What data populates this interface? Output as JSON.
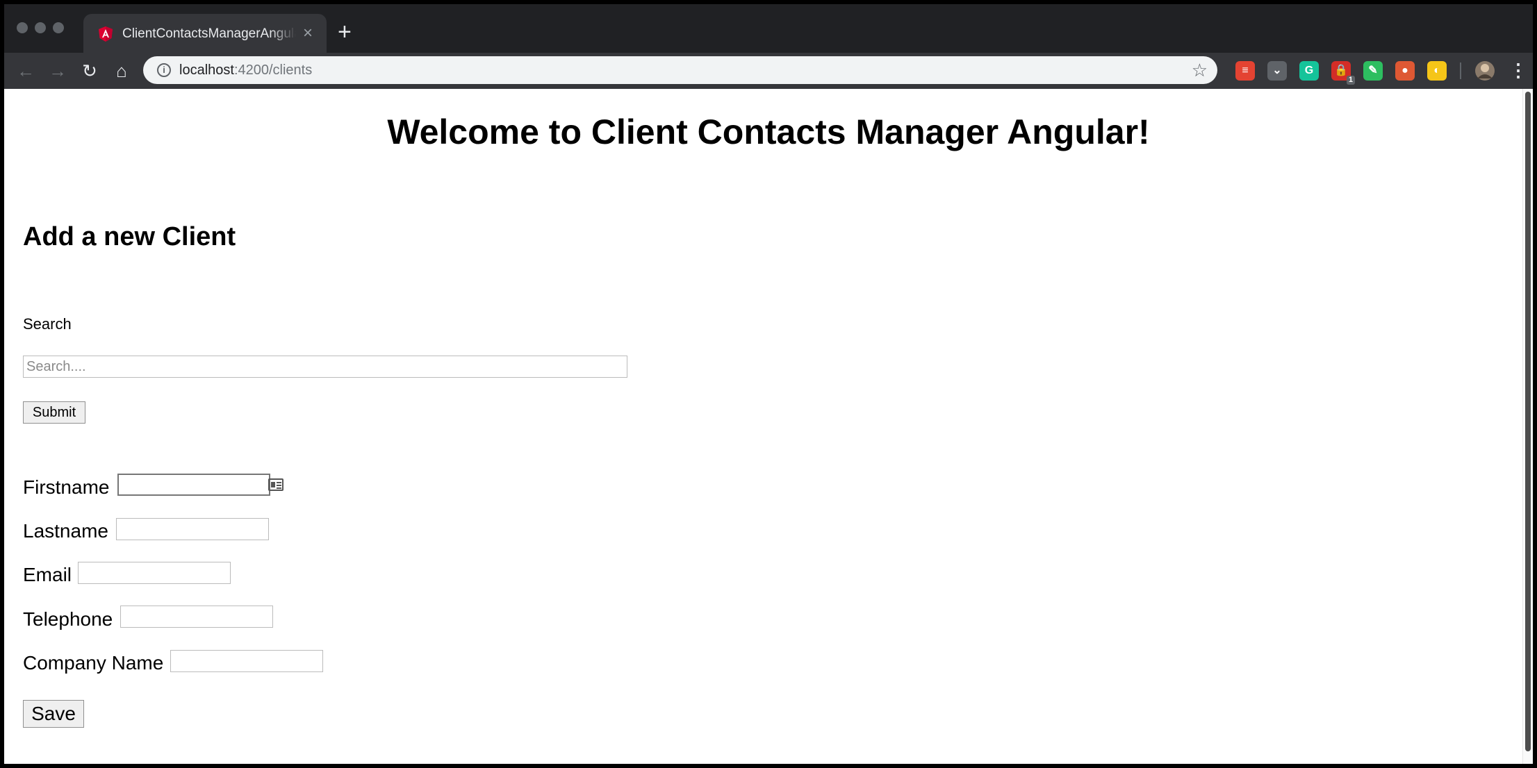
{
  "browser": {
    "tab": {
      "title": "ClientContactsManagerAngular",
      "favicon": "angular-logo-icon",
      "close_glyph": "×"
    },
    "new_tab_glyph": "+",
    "address": {
      "host": "localhost",
      "path": ":4200/clients"
    },
    "extensions": [
      {
        "name": "todoist-extension-icon",
        "color": "#e44332",
        "glyph": "≡"
      },
      {
        "name": "pocket-extension-icon",
        "color": "#5f6368",
        "glyph": "⌄"
      },
      {
        "name": "grammarly-extension-icon",
        "color": "#15c39a",
        "glyph": "G"
      },
      {
        "name": "lastpass-extension-icon",
        "color": "#d32d27",
        "glyph": "🔒",
        "badge": "1"
      },
      {
        "name": "evernote-extension-icon",
        "color": "#2dbe60",
        "glyph": "✎"
      },
      {
        "name": "duckduckgo-extension-icon",
        "color": "#de5833",
        "glyph": "●"
      },
      {
        "name": "yellow-extension-icon",
        "color": "#f5c518",
        "glyph": "◐"
      }
    ]
  },
  "page": {
    "title": "Welcome to Client Contacts Manager Angular!",
    "section_title": "Add a new Client",
    "search": {
      "label": "Search",
      "placeholder": "Search....",
      "submit_label": "Submit"
    },
    "form": {
      "firstname_label": "Firstname",
      "lastname_label": "Lastname",
      "email_label": "Email",
      "telephone_label": "Telephone",
      "company_label": "Company Name",
      "save_label": "Save"
    }
  }
}
